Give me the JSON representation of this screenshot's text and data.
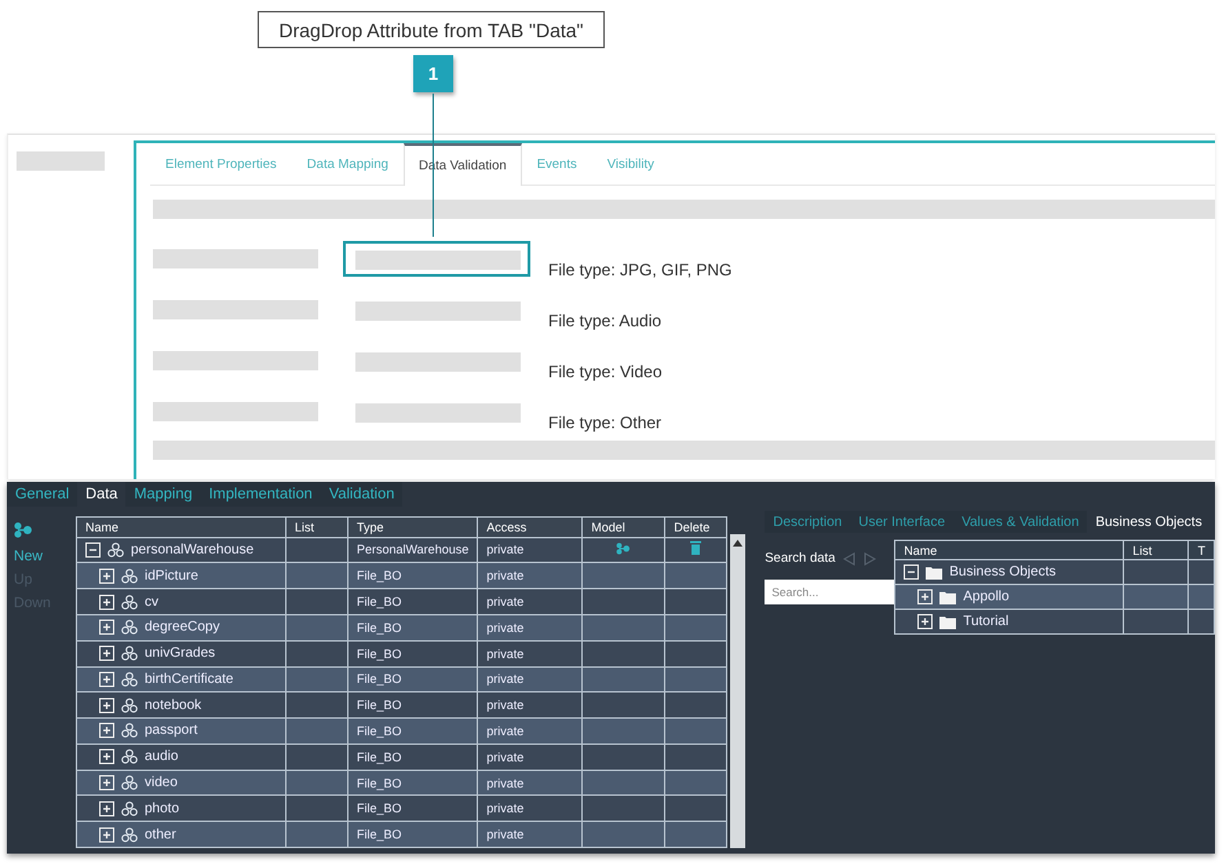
{
  "callout": {
    "text": "DragDrop Attribute from TAB \"Data\"",
    "number": "1"
  },
  "form": {
    "tabs": [
      {
        "label": "Element Properties",
        "selected": false
      },
      {
        "label": "Data Mapping",
        "selected": false
      },
      {
        "label": "Data Validation",
        "selected": true
      },
      {
        "label": "Events",
        "selected": false
      },
      {
        "label": "Visibility",
        "selected": false
      }
    ],
    "rows": [
      {
        "hint": "File type: JPG, GIF, PNG",
        "highlighted": true
      },
      {
        "hint": "File type: Audio",
        "highlighted": false
      },
      {
        "hint": "File type: Video",
        "highlighted": false
      },
      {
        "hint": "File type: Other",
        "highlighted": false
      }
    ]
  },
  "designer": {
    "tabs": [
      {
        "label": "General",
        "selected": false
      },
      {
        "label": "Data",
        "selected": true
      },
      {
        "label": "Mapping",
        "selected": false
      },
      {
        "label": "Implementation",
        "selected": false
      },
      {
        "label": "Validation",
        "selected": false
      }
    ],
    "actions": [
      {
        "label": "New",
        "disabled": false
      },
      {
        "label": "Up",
        "disabled": true
      },
      {
        "label": "Down",
        "disabled": true
      }
    ],
    "table": {
      "columns": [
        "Name",
        "List",
        "Type",
        "Access",
        "Model",
        "Delete"
      ],
      "rows": [
        {
          "name": "personalWarehouse",
          "type": "PersonalWarehouse",
          "access": "private",
          "expanded": true,
          "children": [
            {
              "name": "idPicture",
              "type": "File_BO",
              "access": "private",
              "expanded": false
            },
            {
              "name": "cv",
              "type": "File_BO",
              "access": "private",
              "expanded": false
            },
            {
              "name": "degreeCopy",
              "type": "File_BO",
              "access": "private",
              "expanded": false
            },
            {
              "name": "univGrades",
              "type": "File_BO",
              "access": "private",
              "expanded": false
            },
            {
              "name": "birthCertificate",
              "type": "File_BO",
              "access": "private",
              "expanded": false
            },
            {
              "name": "notebook",
              "type": "File_BO",
              "access": "private",
              "expanded": false
            },
            {
              "name": "passport",
              "type": "File_BO",
              "access": "private",
              "expanded": false
            },
            {
              "name": "audio",
              "type": "File_BO",
              "access": "private",
              "expanded": false
            },
            {
              "name": "video",
              "type": "File_BO",
              "access": "private",
              "expanded": false
            },
            {
              "name": "photo",
              "type": "File_BO",
              "access": "private",
              "expanded": false
            },
            {
              "name": "other",
              "type": "File_BO",
              "access": "private",
              "expanded": false
            }
          ]
        }
      ]
    }
  },
  "side": {
    "tabs": [
      {
        "label": "Description",
        "selected": false
      },
      {
        "label": "User Interface",
        "selected": false
      },
      {
        "label": "Values & Validation",
        "selected": false
      },
      {
        "label": "Business Objects",
        "selected": true
      }
    ],
    "search": {
      "label": "Search data",
      "placeholder": "Search..."
    },
    "tree": {
      "columns": [
        "Name",
        "List",
        "T"
      ],
      "rows": [
        {
          "name": "Business Objects",
          "expanded": true,
          "children": [
            {
              "name": "Appollo",
              "expanded": false
            },
            {
              "name": "Tutorial",
              "expanded": false
            }
          ]
        }
      ]
    }
  }
}
